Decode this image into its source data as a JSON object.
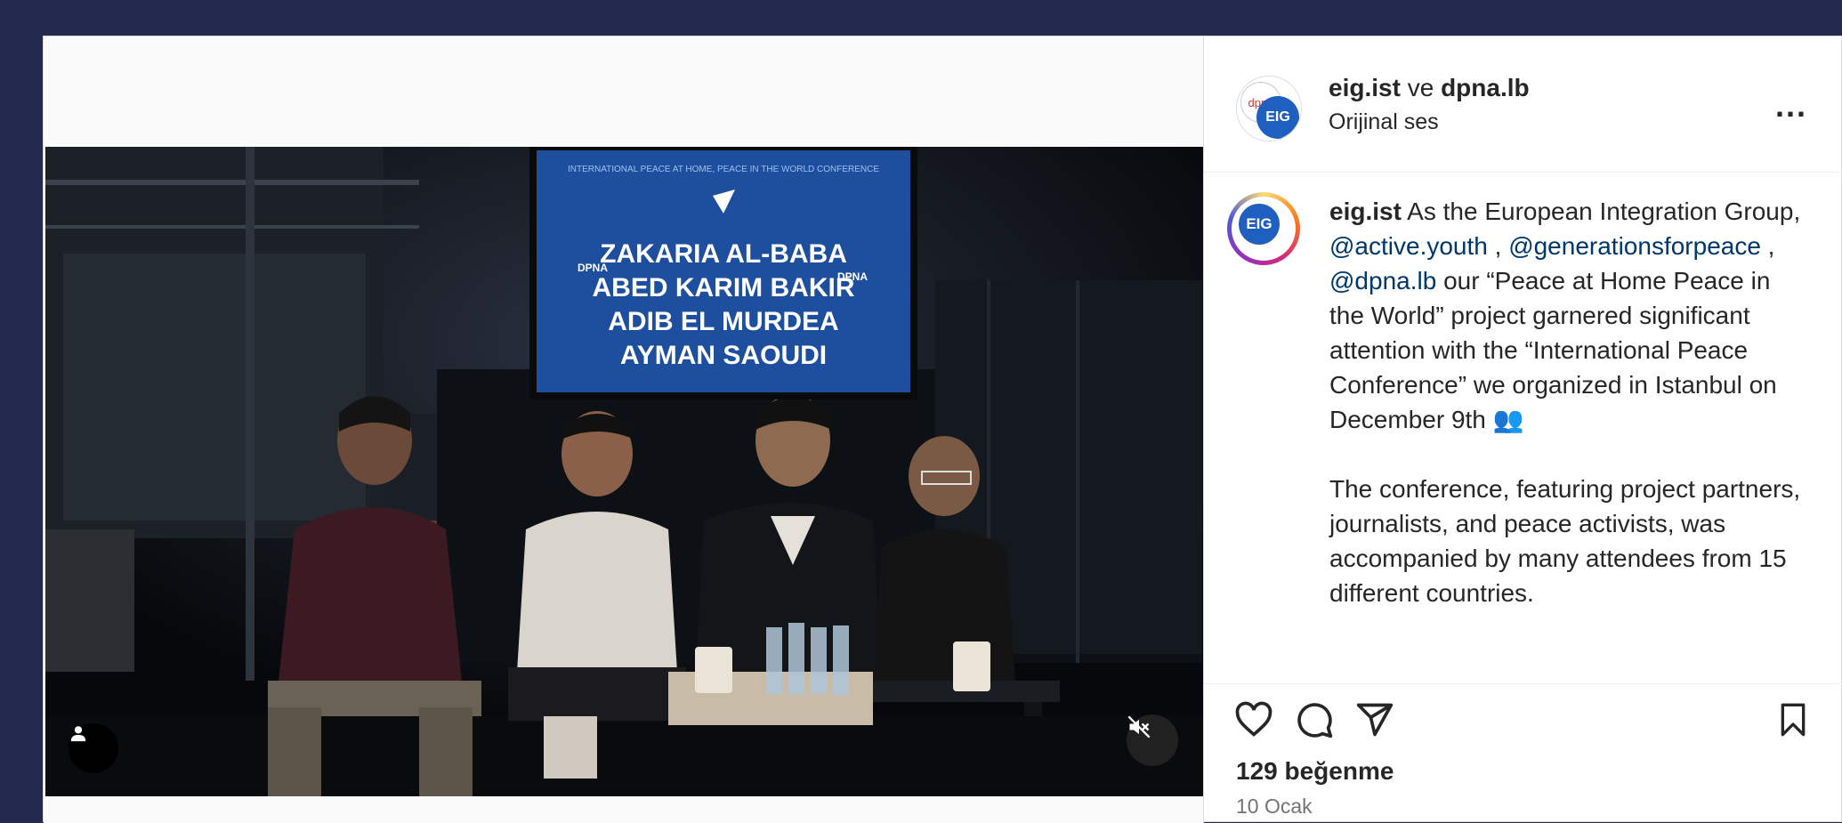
{
  "post": {
    "author_handle": "eig.ist",
    "author_joiner": "ve",
    "collab_handle": "dpna.lb",
    "audio_label": "Orijinal ses",
    "more_label": "..."
  },
  "caption": {
    "handle": "eig.ist",
    "text_1": " As the European Integration Group, ",
    "mention_1": "@active.youth",
    "sep_1": " , ",
    "mention_2": "@generationsforpeace",
    "sep_2": " , ",
    "mention_3": "@dpna.lb",
    "text_2": " our “Peace at Home Peace in the World” project garnered significant attention with the “International Peace Conference” we organized in Istanbul on December 9th 👥",
    "paragraph_2": "The conference, featuring project partners, journalists, and peace activists, was accompanied by many attendees from 15 different countries."
  },
  "video": {
    "screen_header": "INTERNATIONAL PEACE AT HOME, PEACE IN THE WORLD CONFERENCE",
    "speakers": [
      "ZAKARIA AL-BABA",
      "ABED KARIM BAKIR",
      "ADIB EL MURDEA",
      "AYMAN SAOUDI"
    ],
    "screen_logo": "DPNA",
    "muted": true
  },
  "stats": {
    "likes": "129 beğenme",
    "date": "10 Ocak"
  },
  "colors": {
    "background": "#232a4e",
    "mention": "#00376b",
    "screen": "#1d4f9e"
  },
  "icons": [
    "user-tag-icon",
    "mute-icon",
    "heart-icon",
    "comment-icon",
    "share-icon",
    "bookmark-icon",
    "more-icon"
  ]
}
